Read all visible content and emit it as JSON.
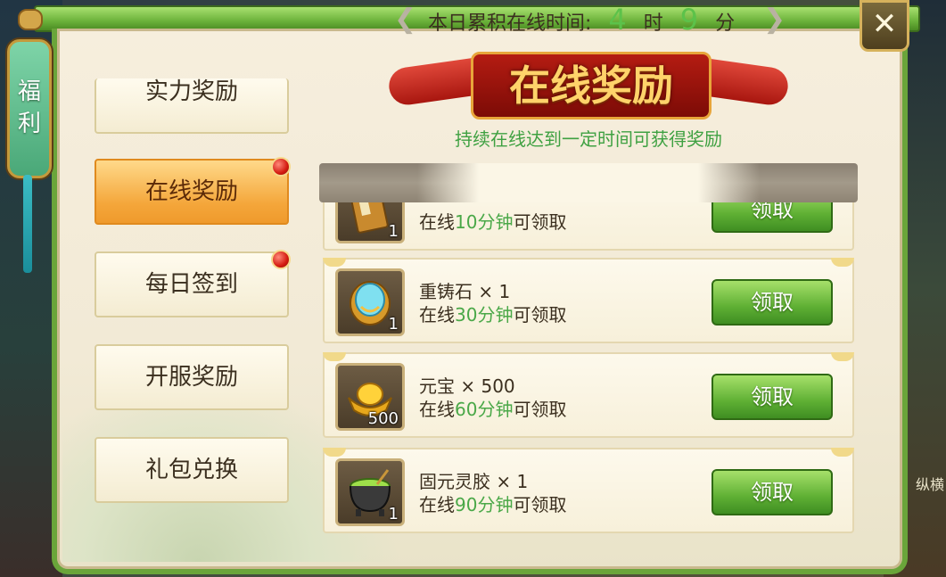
{
  "window": {
    "side_tag": [
      "福",
      "利"
    ],
    "close_label": "✕",
    "title": "在线奖励",
    "subtitle": "持续在线达到一定时间可获得奖励",
    "right_edge_text": "纵横"
  },
  "menu": {
    "items": [
      {
        "label": "实力奖励",
        "active": false,
        "red_dot": false
      },
      {
        "label": "在线奖励",
        "active": true,
        "red_dot": true
      },
      {
        "label": "每日签到",
        "active": false,
        "red_dot": true
      },
      {
        "label": "开服奖励",
        "active": false,
        "red_dot": false
      },
      {
        "label": "礼包兑换",
        "active": false,
        "red_dot": false
      }
    ]
  },
  "online_time": {
    "label": "本日累积在线时间:",
    "hours": "4",
    "hour_unit": "时",
    "minutes": "9",
    "minute_unit": "分"
  },
  "rewards": [
    {
      "icon": "book-icon",
      "name": "",
      "count": "1",
      "cond_prefix": "在线",
      "cond_time": "10分钟",
      "cond_suffix": "可领取",
      "button": "领取"
    },
    {
      "icon": "gem-icon",
      "name": "重铸石 × 1",
      "count": "1",
      "cond_prefix": "在线",
      "cond_time": "30分钟",
      "cond_suffix": "可领取",
      "button": "领取"
    },
    {
      "icon": "gold-ingot-icon",
      "name": "元宝 × 500",
      "count": "500",
      "cond_prefix": "在线",
      "cond_time": "60分钟",
      "cond_suffix": "可领取",
      "button": "领取"
    },
    {
      "icon": "cauldron-icon",
      "name": "固元灵胶 × 1",
      "count": "1",
      "cond_prefix": "在线",
      "cond_time": "90分钟",
      "cond_suffix": "可领取",
      "button": "领取"
    }
  ]
}
